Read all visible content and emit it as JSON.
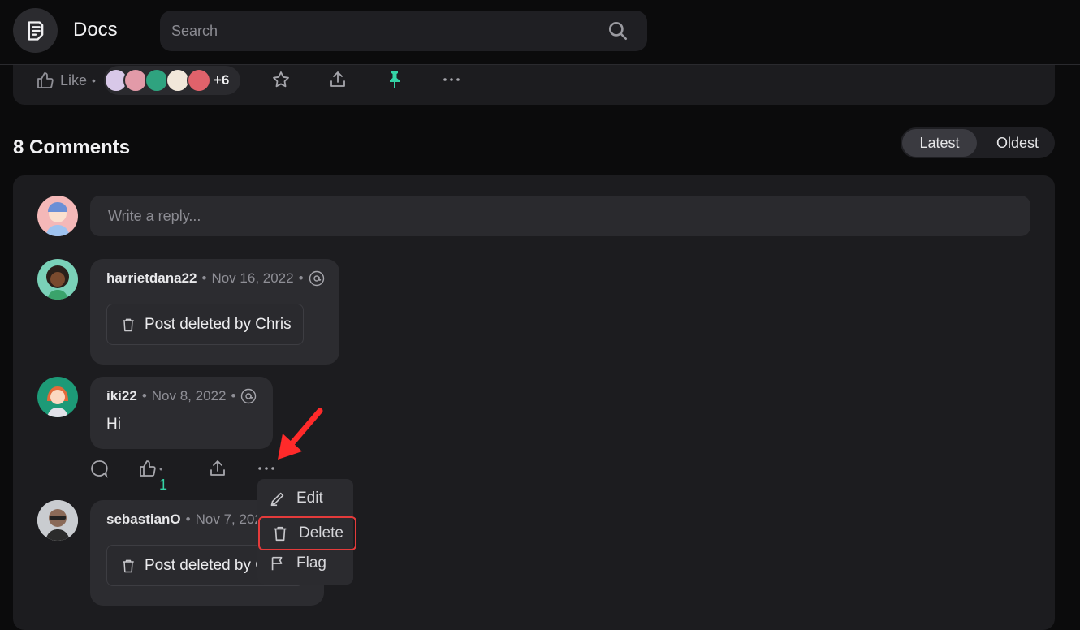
{
  "app": {
    "title": "Docs"
  },
  "search": {
    "placeholder": "Search"
  },
  "post_actions": {
    "like_label": "Like",
    "likers_more": "+6"
  },
  "comments": {
    "count_label": "8 Comments",
    "sort_options": [
      "Latest",
      "Oldest"
    ],
    "sort_selected": "Latest",
    "reply_placeholder": "Write a reply...",
    "items": [
      {
        "author": "harrietdana22",
        "date": "Nov 16, 2022",
        "deleted_text": "Post deleted by Chris"
      },
      {
        "author": "iki22",
        "date": "Nov 8, 2022",
        "text": "Hi",
        "like_count": "1"
      },
      {
        "author": "sebastianO",
        "date": "Nov 7, 2022",
        "deleted_text": "Post deleted by Chris"
      }
    ]
  },
  "context_menu": {
    "items": [
      "Edit",
      "Delete",
      "Flag"
    ],
    "highlighted": "Delete"
  },
  "colors": {
    "accent_green": "#34d3a5",
    "highlight_red": "#e43b3b",
    "background": "#0b0b0c",
    "card": "#1c1c1f"
  }
}
